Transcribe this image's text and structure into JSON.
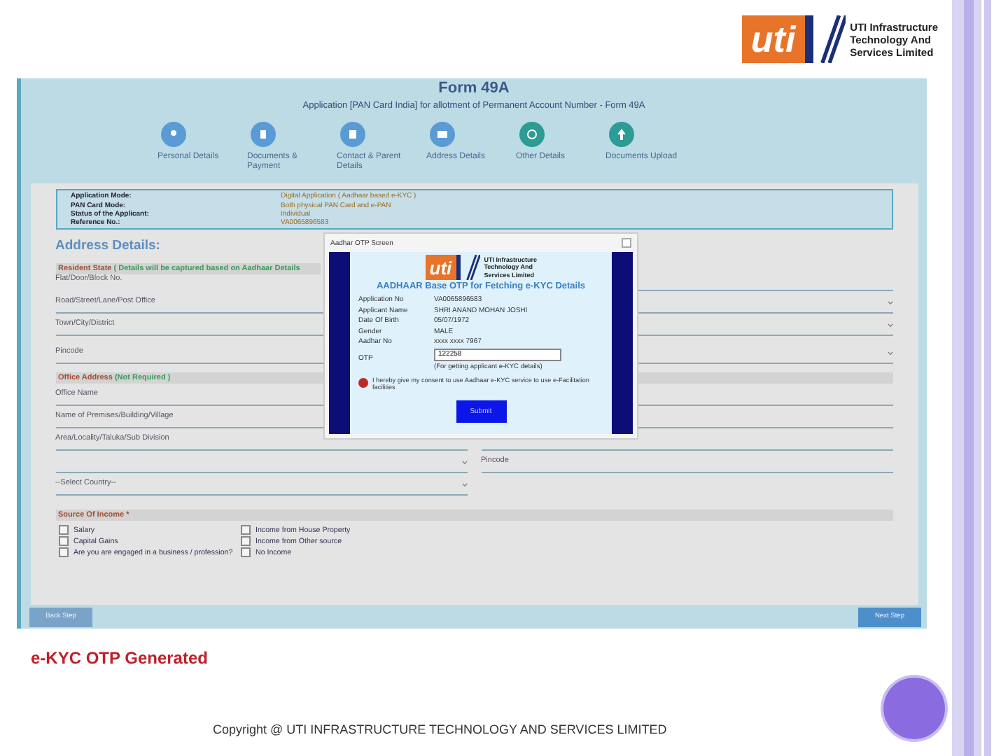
{
  "logo": {
    "mark": "uti",
    "lines": [
      "UTI Infrastructure",
      "Technology And",
      "Services Limited"
    ]
  },
  "form": {
    "title": "Form 49A",
    "subtitle": "Application [PAN Card India] for allotment of Permanent Account Number - Form 49A",
    "steps": [
      {
        "label": "Personal Details",
        "color": "#5b9bd5"
      },
      {
        "label": "Documents & Payment",
        "color": "#5b9bd5"
      },
      {
        "label": "Contact & Parent Details",
        "color": "#5b9bd5"
      },
      {
        "label": "Address Details",
        "color": "#5b9bd5"
      },
      {
        "label": "Other Details",
        "color": "#2e9b94"
      },
      {
        "label": "Documents Upload",
        "color": "#2e9b94"
      }
    ],
    "info": [
      {
        "label": "Application Mode:",
        "value": "Digital Application ( Aadhaar based e-KYC )"
      },
      {
        "label": "PAN Card Mode:",
        "value": "Both physical PAN Card and e-PAN"
      },
      {
        "label": "Status of the Applicant:",
        "value": "Individual"
      },
      {
        "label": "Reference No.:",
        "value": "VA0065896583"
      }
    ],
    "section_title": "Address Details:",
    "resident_bar": {
      "title": "Resident State",
      "note": "( Details will be captured based on Aadhaar Details"
    },
    "resident_fields": [
      "Flat/Door/Block No.",
      "Road/Street/Lane/Post Office",
      "Town/City/District",
      "Pincode"
    ],
    "office_bar": {
      "title": "Office Address",
      "note": "(Not Required )"
    },
    "office_fields": [
      "Office Name",
      "Name of Premises/Building/Village",
      "Area/Locality/Taluka/Sub Division"
    ],
    "office_pincode": "Pincode",
    "country_select": "--Select Country--",
    "income_bar": "Source Of Income *",
    "income_options": [
      {
        "label": "Salary",
        "checked": false
      },
      {
        "label": "Income from House Property",
        "checked": false
      },
      {
        "label": "Capital Gains",
        "checked": false
      },
      {
        "label": "Income from Other source",
        "checked": false
      },
      {
        "label": "Are you are engaged in a business / profession?",
        "checked": false
      },
      {
        "label": "No Income",
        "checked": false
      }
    ],
    "back_button": "Back Step",
    "next_button": "Next Step"
  },
  "dialog": {
    "title": "Aadhar OTP Screen",
    "logo_mark": "uti",
    "logo_lines": [
      "UTI Infrastructure",
      "Technology And",
      "Services Limited"
    ],
    "heading": "AADHAAR Base OTP for Fetching e-KYC Details",
    "rows": [
      {
        "label": "Application No",
        "value": "VA0065896583"
      },
      {
        "label": "Applicant Name",
        "value": "SHRI ANAND MOHAN JOSHI"
      },
      {
        "label": "Date Of Birth",
        "value": "05/07/1972"
      },
      {
        "label": "Gender",
        "value": "MALE"
      },
      {
        "label": "Aadhar No",
        "value": "xxxx xxxx 7967"
      }
    ],
    "otp_label": "OTP",
    "otp_value": "122258",
    "otp_hint": "(For getting applicant e-KYC details)",
    "consent": {
      "text": "I hereby give my consent to use Aadhaar e-KYC service to use e-Facilitation facilities",
      "checked": true
    },
    "submit": "Submit"
  },
  "caption": "e-KYC OTP Generated",
  "copyright": "Copyright @ UTI INFRASTRUCTURE TECHNOLOGY AND SERVICES LIMITED"
}
